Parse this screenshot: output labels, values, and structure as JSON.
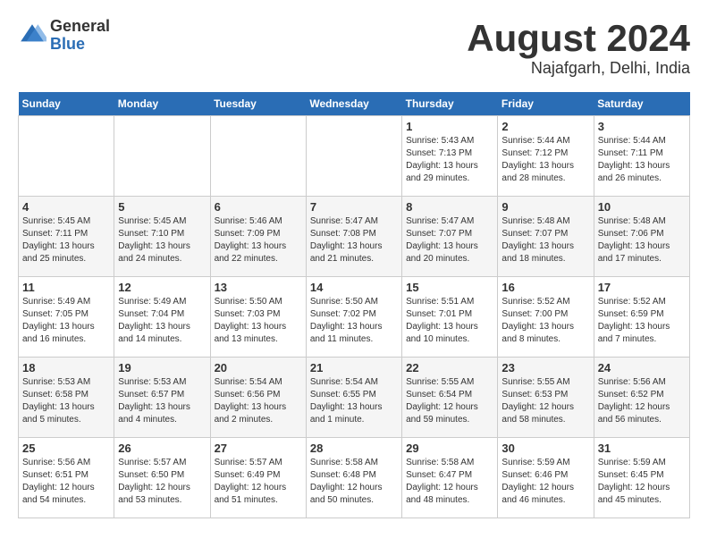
{
  "header": {
    "logo_general": "General",
    "logo_blue": "Blue",
    "title_month": "August 2024",
    "title_location": "Najafgarh, Delhi, India"
  },
  "days_of_week": [
    "Sunday",
    "Monday",
    "Tuesday",
    "Wednesday",
    "Thursday",
    "Friday",
    "Saturday"
  ],
  "weeks": [
    [
      {
        "day": "",
        "info": ""
      },
      {
        "day": "",
        "info": ""
      },
      {
        "day": "",
        "info": ""
      },
      {
        "day": "",
        "info": ""
      },
      {
        "day": "1",
        "info": "Sunrise: 5:43 AM\nSunset: 7:13 PM\nDaylight: 13 hours\nand 29 minutes."
      },
      {
        "day": "2",
        "info": "Sunrise: 5:44 AM\nSunset: 7:12 PM\nDaylight: 13 hours\nand 28 minutes."
      },
      {
        "day": "3",
        "info": "Sunrise: 5:44 AM\nSunset: 7:11 PM\nDaylight: 13 hours\nand 26 minutes."
      }
    ],
    [
      {
        "day": "4",
        "info": "Sunrise: 5:45 AM\nSunset: 7:11 PM\nDaylight: 13 hours\nand 25 minutes."
      },
      {
        "day": "5",
        "info": "Sunrise: 5:45 AM\nSunset: 7:10 PM\nDaylight: 13 hours\nand 24 minutes."
      },
      {
        "day": "6",
        "info": "Sunrise: 5:46 AM\nSunset: 7:09 PM\nDaylight: 13 hours\nand 22 minutes."
      },
      {
        "day": "7",
        "info": "Sunrise: 5:47 AM\nSunset: 7:08 PM\nDaylight: 13 hours\nand 21 minutes."
      },
      {
        "day": "8",
        "info": "Sunrise: 5:47 AM\nSunset: 7:07 PM\nDaylight: 13 hours\nand 20 minutes."
      },
      {
        "day": "9",
        "info": "Sunrise: 5:48 AM\nSunset: 7:07 PM\nDaylight: 13 hours\nand 18 minutes."
      },
      {
        "day": "10",
        "info": "Sunrise: 5:48 AM\nSunset: 7:06 PM\nDaylight: 13 hours\nand 17 minutes."
      }
    ],
    [
      {
        "day": "11",
        "info": "Sunrise: 5:49 AM\nSunset: 7:05 PM\nDaylight: 13 hours\nand 16 minutes."
      },
      {
        "day": "12",
        "info": "Sunrise: 5:49 AM\nSunset: 7:04 PM\nDaylight: 13 hours\nand 14 minutes."
      },
      {
        "day": "13",
        "info": "Sunrise: 5:50 AM\nSunset: 7:03 PM\nDaylight: 13 hours\nand 13 minutes."
      },
      {
        "day": "14",
        "info": "Sunrise: 5:50 AM\nSunset: 7:02 PM\nDaylight: 13 hours\nand 11 minutes."
      },
      {
        "day": "15",
        "info": "Sunrise: 5:51 AM\nSunset: 7:01 PM\nDaylight: 13 hours\nand 10 minutes."
      },
      {
        "day": "16",
        "info": "Sunrise: 5:52 AM\nSunset: 7:00 PM\nDaylight: 13 hours\nand 8 minutes."
      },
      {
        "day": "17",
        "info": "Sunrise: 5:52 AM\nSunset: 6:59 PM\nDaylight: 13 hours\nand 7 minutes."
      }
    ],
    [
      {
        "day": "18",
        "info": "Sunrise: 5:53 AM\nSunset: 6:58 PM\nDaylight: 13 hours\nand 5 minutes."
      },
      {
        "day": "19",
        "info": "Sunrise: 5:53 AM\nSunset: 6:57 PM\nDaylight: 13 hours\nand 4 minutes."
      },
      {
        "day": "20",
        "info": "Sunrise: 5:54 AM\nSunset: 6:56 PM\nDaylight: 13 hours\nand 2 minutes."
      },
      {
        "day": "21",
        "info": "Sunrise: 5:54 AM\nSunset: 6:55 PM\nDaylight: 13 hours\nand 1 minute."
      },
      {
        "day": "22",
        "info": "Sunrise: 5:55 AM\nSunset: 6:54 PM\nDaylight: 12 hours\nand 59 minutes."
      },
      {
        "day": "23",
        "info": "Sunrise: 5:55 AM\nSunset: 6:53 PM\nDaylight: 12 hours\nand 58 minutes."
      },
      {
        "day": "24",
        "info": "Sunrise: 5:56 AM\nSunset: 6:52 PM\nDaylight: 12 hours\nand 56 minutes."
      }
    ],
    [
      {
        "day": "25",
        "info": "Sunrise: 5:56 AM\nSunset: 6:51 PM\nDaylight: 12 hours\nand 54 minutes."
      },
      {
        "day": "26",
        "info": "Sunrise: 5:57 AM\nSunset: 6:50 PM\nDaylight: 12 hours\nand 53 minutes."
      },
      {
        "day": "27",
        "info": "Sunrise: 5:57 AM\nSunset: 6:49 PM\nDaylight: 12 hours\nand 51 minutes."
      },
      {
        "day": "28",
        "info": "Sunrise: 5:58 AM\nSunset: 6:48 PM\nDaylight: 12 hours\nand 50 minutes."
      },
      {
        "day": "29",
        "info": "Sunrise: 5:58 AM\nSunset: 6:47 PM\nDaylight: 12 hours\nand 48 minutes."
      },
      {
        "day": "30",
        "info": "Sunrise: 5:59 AM\nSunset: 6:46 PM\nDaylight: 12 hours\nand 46 minutes."
      },
      {
        "day": "31",
        "info": "Sunrise: 5:59 AM\nSunset: 6:45 PM\nDaylight: 12 hours\nand 45 minutes."
      }
    ]
  ]
}
